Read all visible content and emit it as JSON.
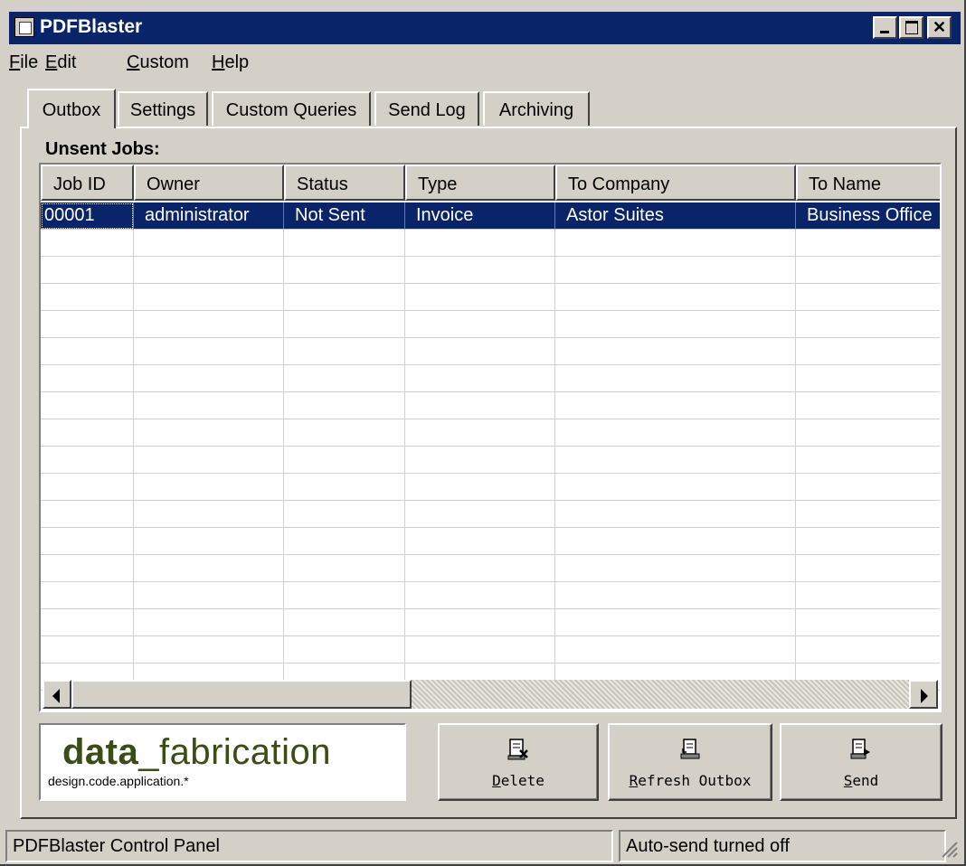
{
  "window": {
    "title": "PDFBlaster"
  },
  "menu": [
    {
      "accel": "F",
      "rest": "ile"
    },
    {
      "accel": "E",
      "rest": "dit"
    },
    {
      "accel": "C",
      "rest": "ustom"
    },
    {
      "accel": "H",
      "rest": "elp"
    }
  ],
  "tabs": [
    {
      "label": "Outbox",
      "active": true
    },
    {
      "label": "Settings",
      "active": false
    },
    {
      "label": "Custom Queries",
      "active": false
    },
    {
      "label": "Send Log",
      "active": false
    },
    {
      "label": "Archiving",
      "active": false
    }
  ],
  "outbox": {
    "section_label": "Unsent Jobs:",
    "columns": [
      "Job ID",
      "Owner",
      "Status",
      "Type",
      "To Company",
      "To Name"
    ],
    "rows": [
      [
        "00001",
        "administrator",
        "Not Sent",
        "Invoice",
        "Astor Suites",
        "Business Office"
      ]
    ],
    "selected_row": 0
  },
  "logo": {
    "word_bold": "data",
    "word_light": "_fabrication",
    "tagline": "design.code.application.*"
  },
  "buttons": {
    "delete": {
      "accel": "D",
      "rest": "elete",
      "icon": "delete-document-icon"
    },
    "refresh": {
      "accel": "R",
      "rest": "efresh Outbox",
      "icon": "refresh-documents-icon"
    },
    "send": {
      "accel": "S",
      "rest": "end",
      "icon": "send-document-icon"
    }
  },
  "status": {
    "left": "PDFBlaster Control Panel",
    "right": "Auto-send turned off"
  },
  "colors": {
    "titlebar": "#0a246a",
    "selection": "#0a246a",
    "face": "#d4d0c8",
    "logo_green": "#3a4d16"
  }
}
